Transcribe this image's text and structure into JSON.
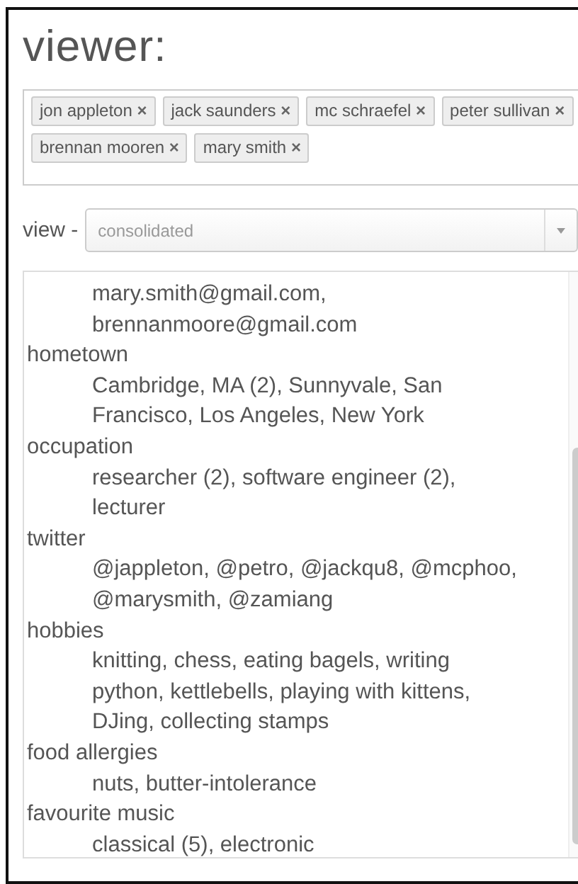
{
  "title": "viewer:",
  "tags": [
    {
      "label": "jon appleton",
      "remove": "×"
    },
    {
      "label": "jack saunders",
      "remove": "×"
    },
    {
      "label": "mc schraefel",
      "remove": "×"
    },
    {
      "label": "peter sullivan",
      "remove": "×"
    },
    {
      "label": "brennan mooren",
      "remove": "×"
    },
    {
      "label": "mary smith",
      "remove": "×"
    }
  ],
  "view": {
    "label": "view -",
    "value": "consolidated"
  },
  "sections": [
    {
      "lines": [
        "mary.smith@gmail.com,",
        "brennanmoore@gmail.com"
      ]
    },
    {
      "label": "hometown",
      "lines": [
        "Cambridge, MA (2), Sunnyvale, San",
        "Francisco, Los Angeles, New York"
      ]
    },
    {
      "label": "occupation",
      "lines": [
        "researcher (2), software engineer (2),",
        "lecturer"
      ]
    },
    {
      "label": "twitter",
      "lines": [
        "@jappleton, @petro, @jackqu8, @mcphoo,",
        "@marysmith, @zamiang"
      ]
    },
    {
      "label": "hobbies",
      "lines": [
        "knitting, chess, eating bagels, writing",
        "python, kettlebells, playing with kittens,",
        "DJing, collecting stamps"
      ]
    },
    {
      "label": "food allergies",
      "lines": [
        "nuts, butter-intolerance"
      ]
    },
    {
      "label": "favourite music",
      "lines": [
        "classical (5), electronic"
      ]
    }
  ]
}
